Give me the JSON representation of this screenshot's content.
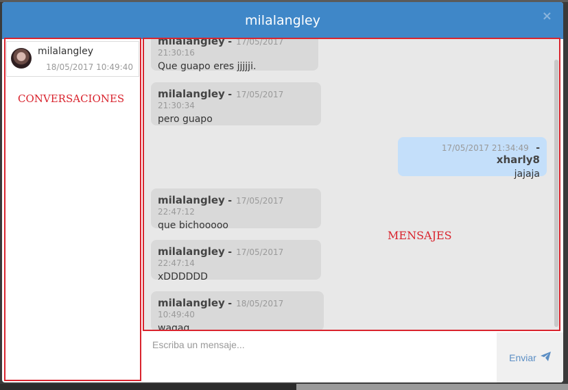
{
  "header": {
    "title": "milalangley",
    "close_label": "×"
  },
  "conversations": {
    "annotation": "CONVERSACIONES",
    "items": [
      {
        "name": "milalangley",
        "date": "18/05/2017 10:49:40"
      }
    ]
  },
  "messages": {
    "annotation": "MENSAJES",
    "items": [
      {
        "direction": "in",
        "user": "milalangley",
        "dash": "-",
        "date": "17/05/2017 21:30:16",
        "text": "Que guapo eres jjjjji."
      },
      {
        "direction": "in",
        "user": "milalangley",
        "dash": "-",
        "date": "17/05/2017 21:30:34",
        "text": "pero guapo"
      },
      {
        "direction": "out",
        "user": "xharly8",
        "dash": "-",
        "date": "17/05/2017 21:34:49",
        "text": "jajaja"
      },
      {
        "direction": "in",
        "user": "milalangley",
        "dash": "-",
        "date": "17/05/2017 22:47:12",
        "text": "que bichooooo"
      },
      {
        "direction": "in",
        "user": "milalangley",
        "dash": "-",
        "date": "17/05/2017 22:47:14",
        "text": "xDDDDDD"
      },
      {
        "direction": "in",
        "user": "milalangley",
        "dash": "-",
        "date": "18/05/2017 10:49:40",
        "text": "wagag"
      }
    ]
  },
  "composer": {
    "placeholder": "Escriba un mensaje...",
    "value": "",
    "send_label": "Enviar",
    "send_icon": "paper-plane-icon"
  },
  "colors": {
    "header": "#3f87c8",
    "annotation": "#d9232d",
    "incoming_bubble": "#d9d9d9",
    "outgoing_bubble": "#c4dffa",
    "send_text": "#5b8ec4"
  }
}
